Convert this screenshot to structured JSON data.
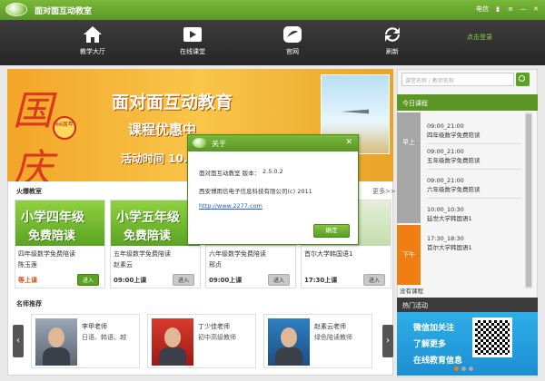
{
  "window": {
    "title": "面对面互动教室",
    "status": "电信",
    "icons": [
      "signal-icon",
      "menu-icon",
      "minimize-icon",
      "close-icon"
    ]
  },
  "nav": {
    "items": [
      "教学大厅",
      "在线课堂",
      "官网",
      "刷新"
    ],
    "icons": [
      "home-icon",
      "video-icon",
      "website-icon",
      "refresh-icon"
    ],
    "login": "点击登录"
  },
  "banner": {
    "festival": "国庆",
    "badge": "66周年",
    "line1": "面对面互动教育",
    "line2": "课程优惠中",
    "line3": "活动时间 10."
  },
  "hot": {
    "title": "火爆教室",
    "more": "更多>>",
    "cards": [
      {
        "img_l1": "小学四年级",
        "img_l2": "免费陪读",
        "name": "四年级数学免费陪读",
        "teacher": "陈玉莲",
        "status": "等上课",
        "button": "进入"
      },
      {
        "img_l1": "小学五年级",
        "img_l2": "免费陪读",
        "name": "五年级数学免费陪读",
        "teacher": "赵素云",
        "status": "09:00上课",
        "button": "进入"
      },
      {
        "img_l1": "",
        "img_l2": "",
        "name": "六年级数学免费陪读",
        "teacher": "邢贞",
        "status": "09:00上课",
        "button": "进入"
      },
      {
        "img_l1": "",
        "img_l2": "",
        "name": "首尔大学韩国语1",
        "teacher": "",
        "status": "17:30上课",
        "button": "进入"
      }
    ]
  },
  "teachers": {
    "title": "名师推荐",
    "list": [
      {
        "name": "李甲老师",
        "subject": "日语、韩语、越"
      },
      {
        "name": "丁少佳老师",
        "subject": "初中高级教师"
      },
      {
        "name": "赵素云老师",
        "subject": "绿色陪读教师"
      }
    ]
  },
  "search": {
    "placeholder": "课堂名称 / 教师名称"
  },
  "schedule": {
    "title": "今日课程",
    "am": "早上",
    "pm": "下午",
    "courses": [
      {
        "time": "09:00_21:00",
        "name": "四年级数学免费陪读"
      },
      {
        "time": "09:00_21:00",
        "name": "五年级数学免费陪读"
      },
      {
        "time": "09:00_21:00",
        "name": "六年级数学免费陪读"
      },
      {
        "time": "10:00_10:30",
        "name": "延世大学韩国语1"
      },
      {
        "time": "17:30_18:30",
        "name": "首尔大学韩国语1"
      }
    ],
    "more": "没有课程"
  },
  "promo": {
    "title": "热门活动",
    "line1": "微信加关注",
    "line2": "了解更多",
    "line3": "在线教育信息"
  },
  "dialog": {
    "title": "关于",
    "line1": "面对面互动教室  版本：",
    "version": "2.5.0.2",
    "company": "西安博雨信电子信息科技有限公司(c) 2011",
    "link": "http://www.2277.com",
    "ok": "确定"
  }
}
